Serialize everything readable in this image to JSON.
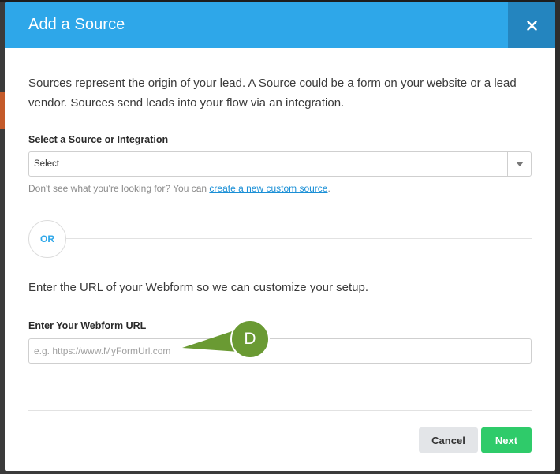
{
  "modal": {
    "title": "Add a Source",
    "close_icon": "close-icon",
    "intro": "Sources represent the origin of your lead. A Source could be a form on your website or a lead vendor. Sources send leads into your flow via an integration."
  },
  "source_select": {
    "label": "Select a Source or Integration",
    "value": "Select",
    "caret_icon": "caret-down-icon"
  },
  "helper": {
    "prefix": "Don't see what you're looking for? You can ",
    "link": "create a new custom source",
    "suffix": "."
  },
  "divider": {
    "or_label": "OR"
  },
  "webform": {
    "prompt": "Enter the URL of your Webform so we can customize your setup.",
    "label": "Enter Your Webform URL",
    "value": "",
    "placeholder": "e.g. https://www.MyFormUrl.com"
  },
  "annotation": {
    "label": "D",
    "color": "#6a9a33"
  },
  "footer": {
    "cancel_label": "Cancel",
    "next_label": "Next"
  },
  "colors": {
    "header": "#2ea7e9",
    "close_bg": "#2485bf",
    "link": "#1a8fd6",
    "next_button": "#2fcb6a",
    "cancel_button": "#e3e5e8"
  }
}
